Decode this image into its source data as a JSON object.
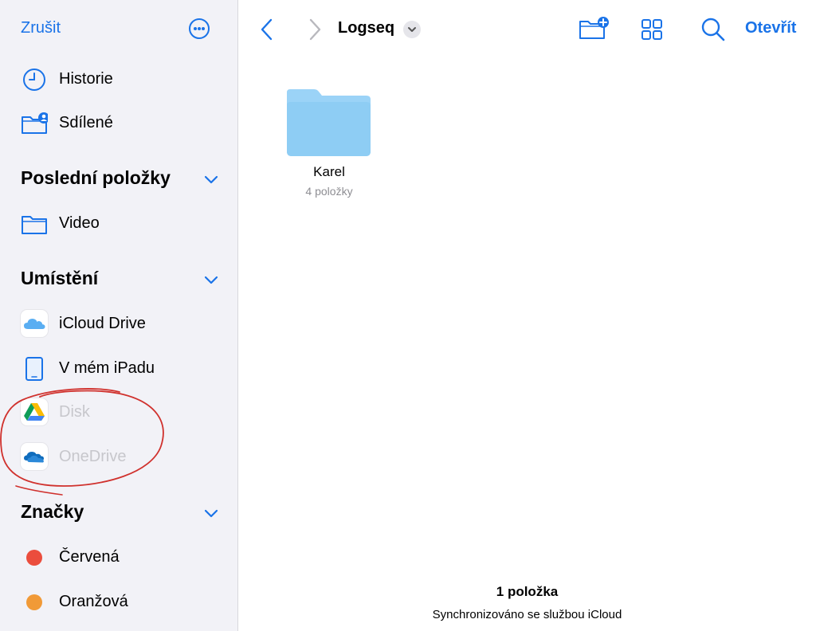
{
  "sidebar": {
    "cancel_label": "Zrušit",
    "top_items": [
      {
        "label": "Historie",
        "icon": "clock-icon"
      },
      {
        "label": "Sdílené",
        "icon": "shared-folder-icon"
      }
    ],
    "sections": [
      {
        "title": "Poslední položky",
        "items": [
          {
            "label": "Video",
            "icon": "folder-icon"
          }
        ]
      },
      {
        "title": "Umístění",
        "items": [
          {
            "label": "iCloud Drive",
            "icon": "icloud-icon"
          },
          {
            "label": "V mém iPadu",
            "icon": "ipad-icon"
          },
          {
            "label": "Disk",
            "icon": "google-drive-icon",
            "disabled": true
          },
          {
            "label": "OneDrive",
            "icon": "onedrive-icon",
            "disabled": true
          }
        ]
      },
      {
        "title": "Značky",
        "items": [
          {
            "label": "Červená",
            "color": "#eb4d3d"
          },
          {
            "label": "Oranžová",
            "color": "#f19a37"
          }
        ]
      }
    ]
  },
  "toolbar": {
    "breadcrumb": "Logseq",
    "open_label": "Otevřít"
  },
  "content": {
    "items": [
      {
        "name": "Karel",
        "subtitle": "4 položky",
        "icon": "folder-icon"
      }
    ]
  },
  "footer": {
    "count": "1 položka",
    "sync_status": "Synchronizováno se službou iCloud"
  },
  "colors": {
    "accent": "#1a73e8",
    "sidebar_bg": "#f2f2f7",
    "folder": "#8ecdf4",
    "annotation": "#d0312d"
  }
}
